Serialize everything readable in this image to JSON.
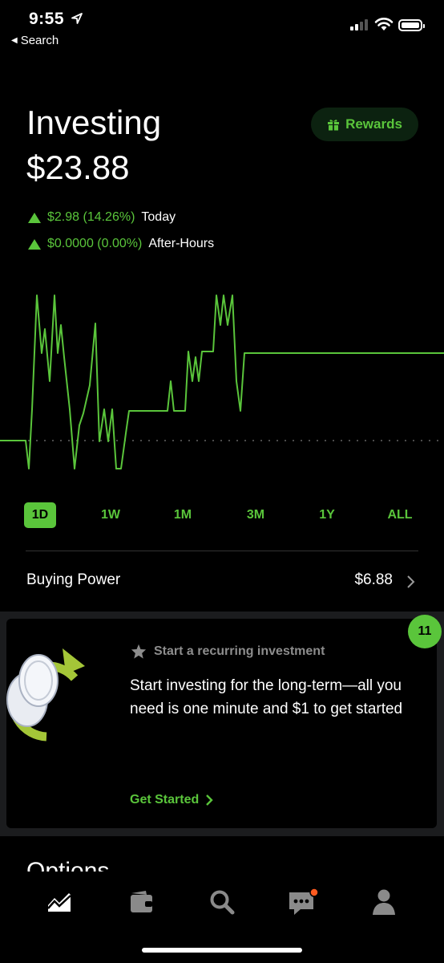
{
  "status_bar": {
    "time": "9:55",
    "back_label": "Search"
  },
  "header": {
    "title": "Investing",
    "portfolio_value": "$23.88",
    "rewards_label": "Rewards",
    "today_change": "$2.98 (14.26%)",
    "today_label": "Today",
    "after_hours_change": "$0.0000 (0.00%)",
    "after_hours_label": "After-Hours"
  },
  "colors": {
    "accent": "#5ac53b",
    "background": "#000000",
    "card_band": "#1b1c1e",
    "notification": "#ff5a1f"
  },
  "ranges": [
    {
      "label": "1D",
      "active": true
    },
    {
      "label": "1W",
      "active": false
    },
    {
      "label": "1M",
      "active": false
    },
    {
      "label": "3M",
      "active": false
    },
    {
      "label": "1Y",
      "active": false
    },
    {
      "label": "ALL",
      "active": false
    }
  ],
  "buying_power": {
    "label": "Buying Power",
    "value": "$6.88"
  },
  "card": {
    "badge_count": "11",
    "eyebrow": "Start a recurring investment",
    "body": "Start investing for the long-term—all you need is one minute and $1 to get started",
    "cta": "Get Started"
  },
  "options_heading": "Options",
  "tab_bar": {
    "icons": [
      "chart-icon",
      "wallet-icon",
      "search-icon",
      "messages-icon",
      "account-icon"
    ]
  }
}
